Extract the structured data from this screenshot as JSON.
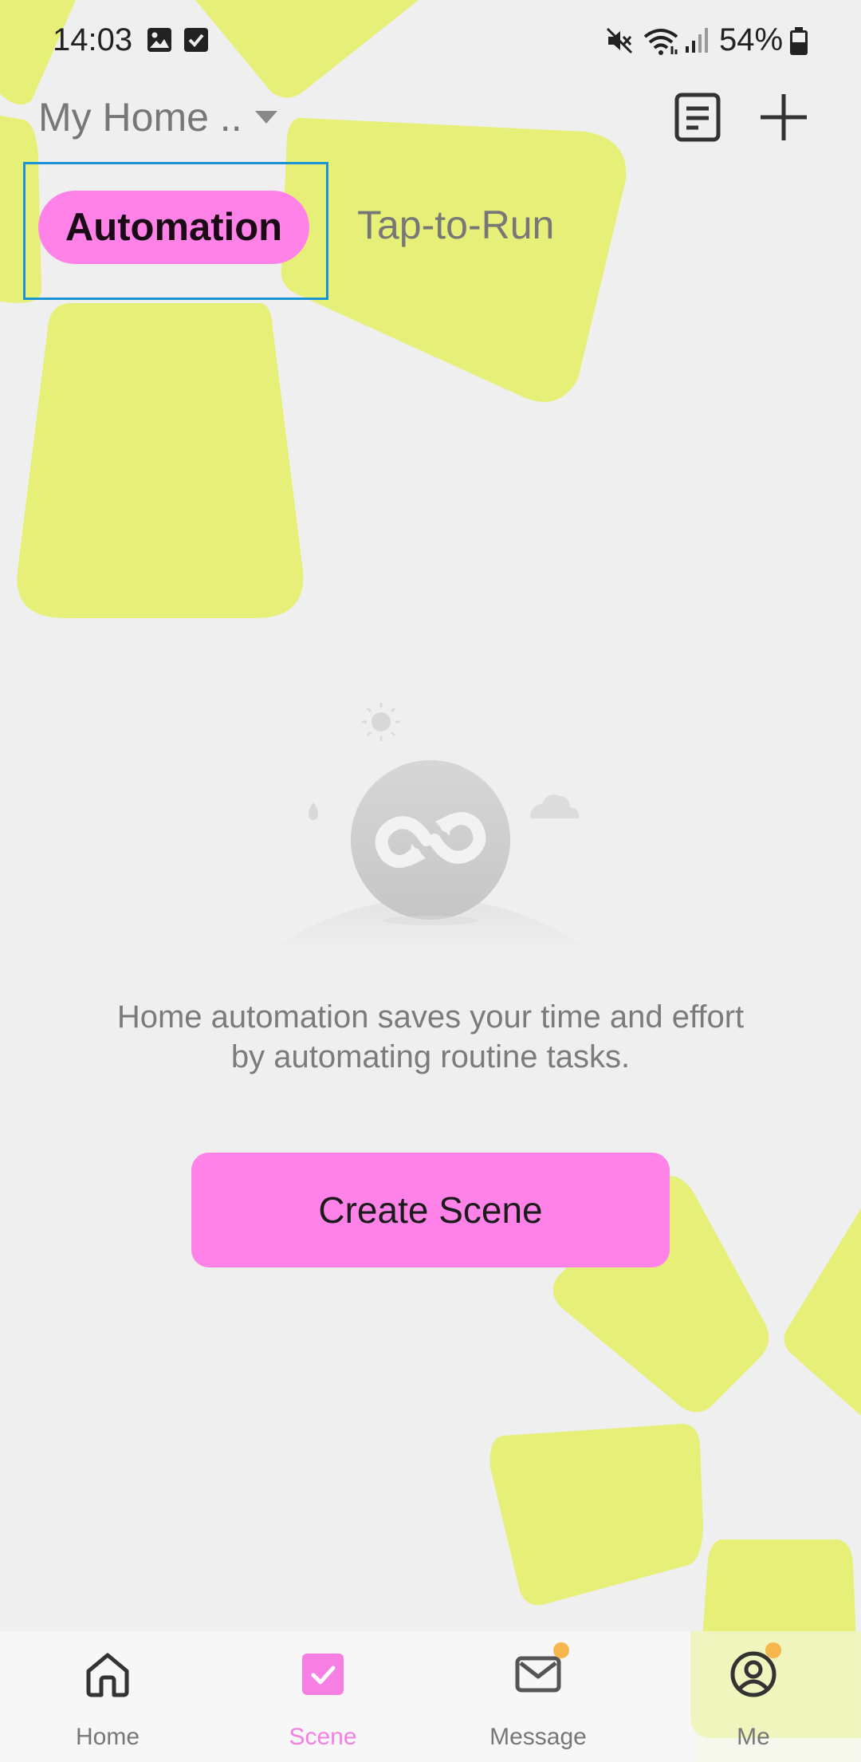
{
  "status_bar": {
    "time": "14:03",
    "battery": "54%",
    "icons": [
      "image-icon",
      "check-box-icon",
      "mute-icon",
      "wifi-icon",
      "signal-icon",
      "battery-icon"
    ]
  },
  "header": {
    "home_title": "My Home ..",
    "icons": [
      "dropdown-arrow-icon",
      "log-icon",
      "plus-icon"
    ]
  },
  "tabs": [
    {
      "label": "Automation",
      "active": true
    },
    {
      "label": "Tap-to-Run",
      "active": false
    }
  ],
  "empty_state": {
    "line1": "Home automation saves your time and effort",
    "line2": "by automating routine tasks.",
    "button": "Create Scene",
    "icon": "automation-loop-icon"
  },
  "bottom_nav": [
    {
      "label": "Home",
      "icon": "home-icon",
      "active": false
    },
    {
      "label": "Scene",
      "icon": "scene-check-icon",
      "active": true
    },
    {
      "label": "Message",
      "icon": "mail-icon",
      "active": false,
      "badge": true
    },
    {
      "label": "Me",
      "icon": "user-icon",
      "active": false,
      "badge": true
    }
  ],
  "colors": {
    "background": "#efefef",
    "accent_pink": "#ff82e9",
    "decor_yellow": "#e6ef78",
    "focus_border": "#1a93d3",
    "badge": "#f7b64c"
  }
}
